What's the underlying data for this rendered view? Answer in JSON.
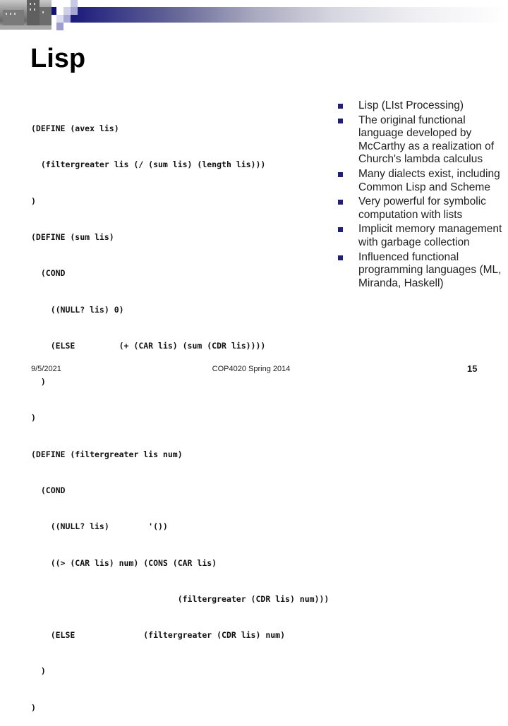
{
  "slide": {
    "title": "Lisp",
    "code_lines": [
      "(DEFINE (avex lis)",
      "  (filtergreater lis (/ (sum lis) (length lis)))",
      ")",
      "(DEFINE (sum lis)",
      "  (COND",
      "    ((NULL? lis) 0)",
      "    (ELSE         (+ (CAR lis) (sum (CDR lis))))",
      "  )",
      ")",
      "(DEFINE (filtergreater lis num)",
      "  (COND",
      "    ((NULL? lis)        '())",
      "    ((> (CAR lis) num) (CONS (CAR lis)",
      "                              (filtergreater (CDR lis) num)))",
      "    (ELSE              (filtergreater (CDR lis) num)",
      "  )",
      ")"
    ],
    "bullets": [
      {
        "text": "Lisp (LIst Processing)",
        "icon": "square-bullet-icon"
      },
      {
        "text": "The original functional language developed by McCarthy as a realization of Church's lambda calculus",
        "icon": "square-bullet-icon"
      },
      {
        "text": "Many dialects exist, including Common Lisp and Scheme",
        "icon": "square-bullet-icon"
      },
      {
        "text": "Very powerful for symbolic computation with lists",
        "icon": "square-bullet-icon"
      },
      {
        "text": "Implicit memory management with garbage collection",
        "icon": "square-bullet-icon"
      },
      {
        "text": "Influenced functional programming languages (ML, Miranda, Haskell)",
        "icon": "square-bullet-icon"
      }
    ]
  },
  "footer": {
    "date": "9/5/2021",
    "course": "COP4020 Spring 2014",
    "page_number": "15"
  },
  "colors": {
    "accent_navy": "#1f1f7a",
    "bullet": "#1f1f7a"
  }
}
